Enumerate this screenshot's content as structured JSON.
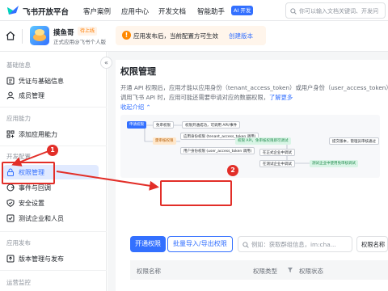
{
  "topnav": {
    "brand": "飞书开放平台",
    "items": [
      "客户案例",
      "应用中心",
      "开发文档",
      "智能助手"
    ],
    "ai_badge": "AI 开发",
    "search_placeholder": "你可以输入文档关键词、开发问"
  },
  "app": {
    "name": "摸鱼哥",
    "badge": "待上线",
    "subtitle": "正式应用@飞书个人版",
    "notice": "应用发布后，当前配置方可生效",
    "notice_link": "创建版本"
  },
  "sidebar": {
    "sections": [
      {
        "title": "基础信息",
        "items": [
          "凭证与基础信息",
          "成员管理"
        ]
      },
      {
        "title": "应用能力",
        "items": [
          "添加应用能力"
        ]
      },
      {
        "title": "开发配置",
        "items": [
          "权限管理",
          "事件与回调",
          "安全设置",
          "测试企业和人员"
        ]
      },
      {
        "title": "应用发布",
        "items": [
          "版本管理与发布"
        ]
      },
      {
        "title": "运营监控",
        "items": []
      }
    ],
    "active": "权限管理",
    "collapse_glyph": "«"
  },
  "main": {
    "title": "权限管理",
    "desc_line1": "开通 API 权限后，应用才能以应用身份（tenant_access_token）或用户身份（user_access_token）",
    "desc_line2": "调用飞书 API 时，应用可能还需要申请对应的数据权限，",
    "learn_more": "了解更多",
    "collapse": "收起介绍",
    "diagram": {
      "nodes": [
        "申请权限",
        "免审权限",
        "权限开通成功，可调用 API/事件",
        "需审核权限",
        "应用身份权限 (tenant_access_token 调用)",
        "如应用开发者身份请用",
        "权限 API，免审核权限即可调试",
        "用户身份权限 (user_access_token 调用)",
        "在正式企业中调试",
        "在测试企业中调试",
        "测试企业中使用免审核调试",
        "提交版本，管理员审核通过"
      ]
    },
    "buttons": {
      "enable": "开通权限",
      "batch": "批量导入/导出权限"
    },
    "search_placeholder": "例如：获取群组信息，im:cha...",
    "filter": "权限名称",
    "table_headers": [
      "权限名称",
      "权限类型",
      "权限状态"
    ]
  },
  "annotations": {
    "step1": "1",
    "step2": "2"
  },
  "colors": {
    "primary": "#3370ff",
    "annotation": "#e22e28",
    "notice_bg": "#fff5eb"
  }
}
